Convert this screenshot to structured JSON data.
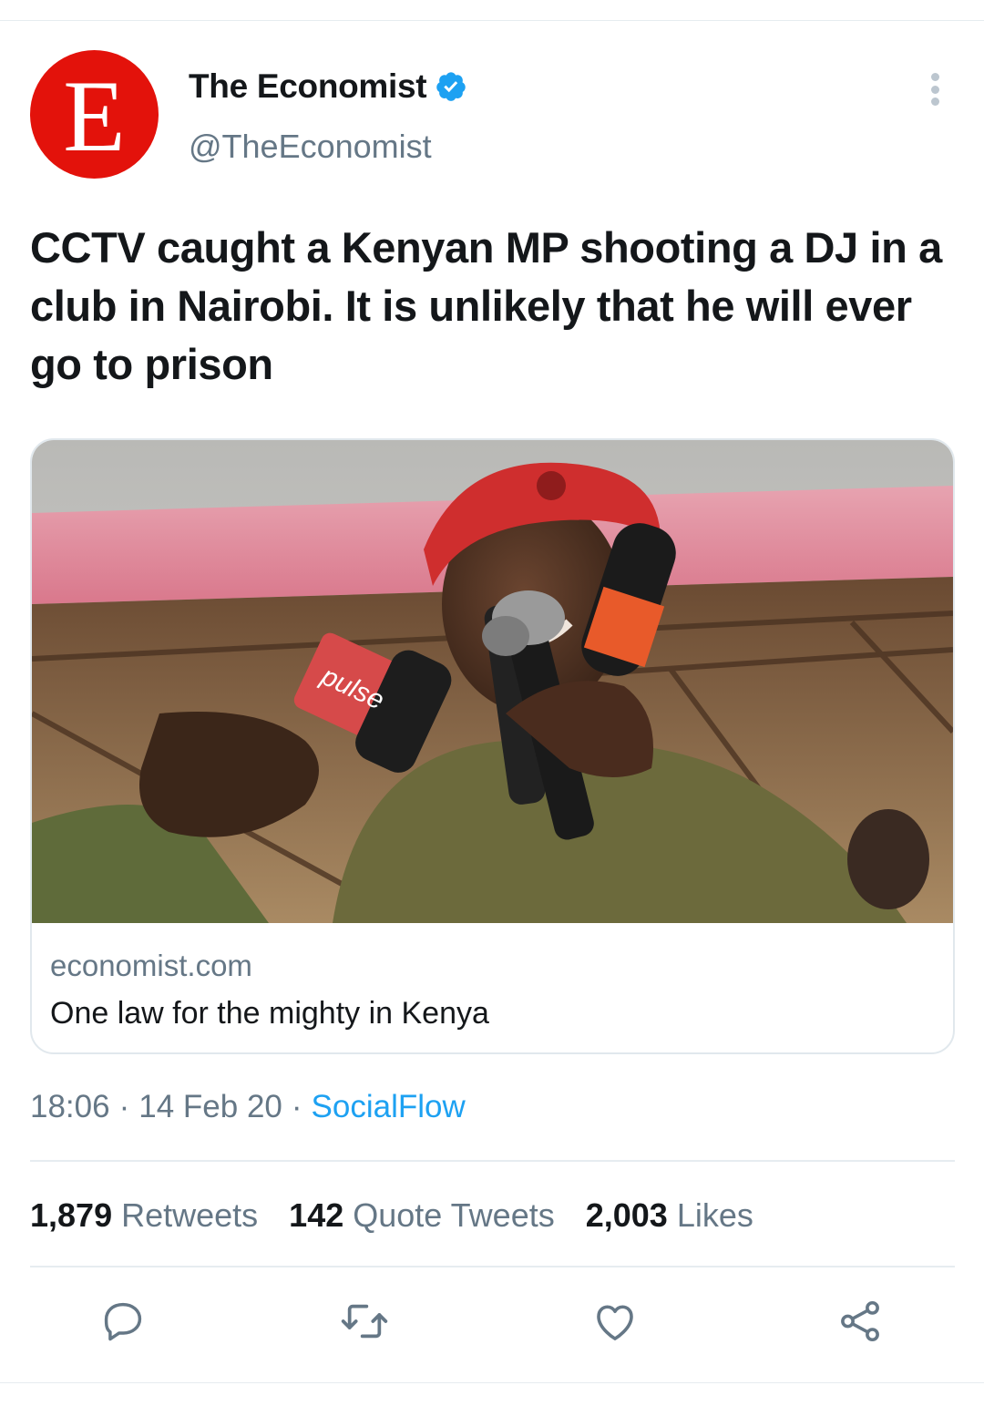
{
  "tweet": {
    "avatar_letter": "E",
    "display_name": "The Economist",
    "handle": "@TheEconomist",
    "verified": true,
    "text": "CCTV caught a Kenyan MP shooting a DJ in a club in Nairobi. It is unlikely that he will ever go to prison",
    "card": {
      "image_alt": "Man in red beret speaking into microphones",
      "domain": "economist.com",
      "title": "One law for the mighty in Kenya"
    },
    "time": "18:06",
    "date": "14 Feb 20",
    "separator": "·",
    "source": "SocialFlow",
    "stats": {
      "retweets_count": "1,879",
      "retweets_label": "Retweets",
      "quotes_count": "142",
      "quotes_label": "Quote Tweets",
      "likes_count": "2,003",
      "likes_label": "Likes"
    }
  },
  "icons": {
    "verified": "verified-badge-icon",
    "more": "more-vertical-icon",
    "reply": "reply-icon",
    "retweet": "retweet-icon",
    "like": "heart-icon",
    "share": "share-icon"
  },
  "colors": {
    "brand_red": "#e3120b",
    "link_blue": "#1da1f2",
    "secondary_text": "#657786",
    "icon_gray": "#657786"
  }
}
